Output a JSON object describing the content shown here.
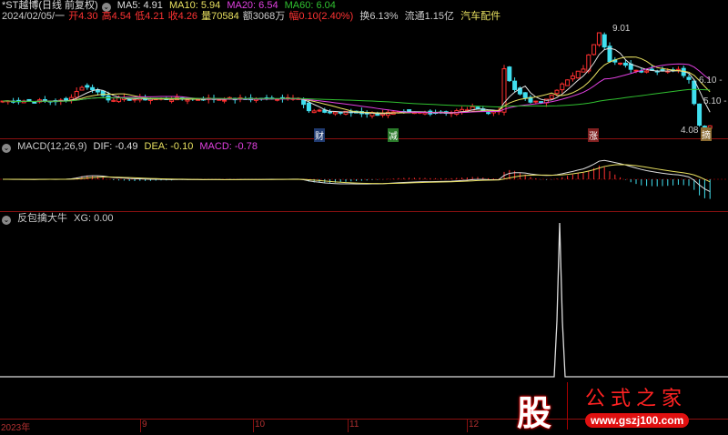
{
  "header": {
    "title": "*ST越博(日线 前复权)",
    "ma5": "MA5: 4.91",
    "ma10": "MA10: 5.94",
    "ma20": "MA20: 6.54",
    "ma60": "MA60: 6.04"
  },
  "quote": {
    "date": "2024/02/05/一",
    "open": "开4.30",
    "high": "高4.54",
    "low": "低4.21",
    "close": "收4.26",
    "vol": "量70584",
    "amount": "额3068万",
    "change": "幅0.10(2.40%)",
    "turnover": "换6.13%",
    "float": "流通1.15亿",
    "sector": "汽车配件"
  },
  "price_labels": {
    "high": "9.01",
    "low": "4.08",
    "scale1": "6.10 -",
    "scale2": "5.10 -"
  },
  "markers": {
    "cai": "财",
    "jian": "减",
    "zhang": "涨",
    "zhai": "摘"
  },
  "macd": {
    "title": "MACD(12,26,9)",
    "dif": "DIF: -0.49",
    "dea": "DEA: -0.10",
    "macd": "MACD: -0.78"
  },
  "xg": {
    "title": "反包擒大牛",
    "value": "XG: 0.00"
  },
  "axis": [
    "2023年",
    "9",
    "10",
    "11",
    "12"
  ],
  "logo": {
    "char": "股",
    "name": "公式之家",
    "url": "www.gszj100.com"
  },
  "colors": {
    "up": "#ff3030",
    "down": "#40e0f0",
    "ma5": "#e0e0e0",
    "ma10": "#e8e060",
    "ma20": "#e040e0",
    "ma60": "#30c030"
  },
  "chart_data": {
    "type": "candlestick",
    "keypoints": [
      [
        0,
        5.5
      ],
      [
        12,
        5.5
      ],
      [
        15,
        6.2
      ],
      [
        17,
        6.1
      ],
      [
        20,
        5.6
      ],
      [
        50,
        5.6
      ],
      [
        56,
        5.7
      ],
      [
        58,
        5.0
      ],
      [
        70,
        4.9
      ],
      [
        85,
        4.95
      ],
      [
        90,
        5.2
      ],
      [
        92,
        4.9
      ],
      [
        94,
        5.1
      ],
      [
        95,
        7.0
      ],
      [
        97,
        6.0
      ],
      [
        100,
        5.5
      ],
      [
        102,
        5.4
      ],
      [
        106,
        6.3
      ],
      [
        110,
        7.1
      ],
      [
        113,
        8.9
      ],
      [
        115,
        7.5
      ],
      [
        120,
        7.0
      ],
      [
        128,
        7.0
      ],
      [
        130,
        6.6
      ],
      [
        132,
        4.3
      ],
      [
        134,
        4.3
      ]
    ],
    "count": 135,
    "ylim": [
      4.0,
      9.3
    ]
  }
}
